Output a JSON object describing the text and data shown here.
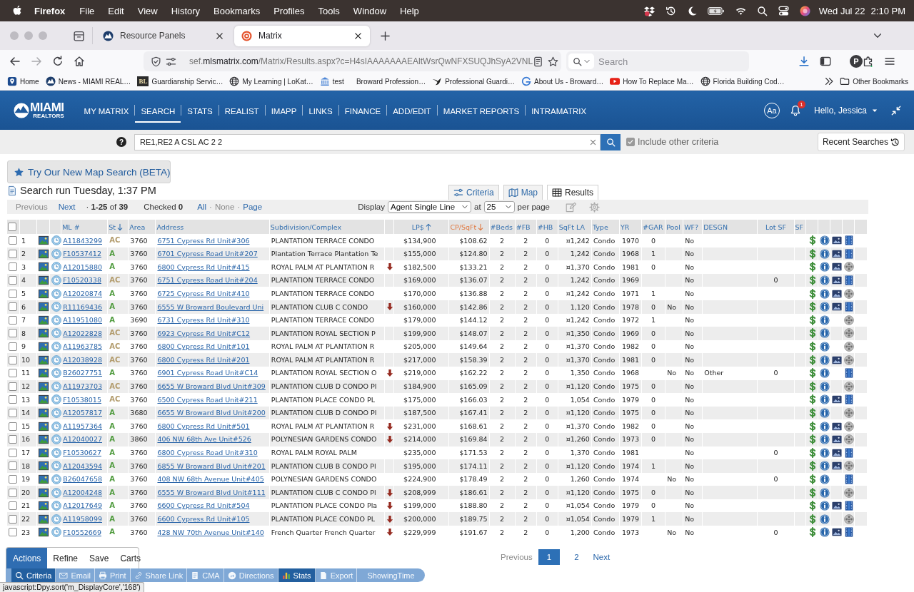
{
  "menu_bar": {
    "app": "Firefox",
    "menus": [
      "File",
      "Edit",
      "View",
      "History",
      "Bookmarks",
      "Profiles",
      "Tools",
      "Window",
      "Help"
    ],
    "date": "Wed Jul 22",
    "time": "2:10 PM"
  },
  "browser": {
    "tabs": [
      {
        "title": "Resource Panels",
        "kind": "realtors",
        "selected": false
      },
      {
        "title": "Matrix",
        "kind": "matrix",
        "selected": true
      }
    ],
    "url": {
      "subdomain": "sef.",
      "domain": "mlsmatrix.com",
      "path": "/Matrix/Results.aspx?c=H4sIAAAAAAAEAltWsrQwNFXSUQJhSyA2VNL"
    },
    "search_placeholder": "Search",
    "profile_initial": "P",
    "bookmarks": [
      {
        "label": "Home",
        "kind": "pin"
      },
      {
        "label": "News - MIAMI REAL…",
        "kind": "realtors"
      },
      {
        "label": "Guardianship Servic…",
        "kind": "monogram",
        "icon_text": "BL"
      },
      {
        "label": "My Learning | LoKat…",
        "kind": "globe"
      },
      {
        "label": "test",
        "kind": "bank"
      },
      {
        "label": "Broward Profession…"
      },
      {
        "label": "Professional Guardi…",
        "kind": "bird"
      },
      {
        "label": "About Us - Broward…",
        "kind": "swirl"
      },
      {
        "label": "How To Replace Ma…",
        "kind": "video"
      },
      {
        "label": "Florida Building Cod…",
        "kind": "globe"
      }
    ],
    "other_bookmarks": "Other Bookmarks"
  },
  "site_header": {
    "logo": {
      "title": "MIAMI",
      "subtitle": "REALTORS"
    },
    "nav": [
      {
        "label": "MY MATRIX",
        "selected": false
      },
      {
        "label": "SEARCH",
        "selected": true
      },
      {
        "label": "STATS",
        "selected": false
      },
      {
        "label": "REALIST",
        "selected": false
      },
      {
        "label": "IMAPP",
        "selected": false
      },
      {
        "label": "LINKS",
        "selected": false
      },
      {
        "label": "FINANCE",
        "selected": false
      },
      {
        "label": "ADD/EDIT",
        "selected": false
      },
      {
        "label": "MARKET REPORTS",
        "selected": false
      },
      {
        "label": "INTRAMATRIX",
        "selected": false
      }
    ],
    "text_size": "Aa",
    "notification_count": "1",
    "greeting": "Hello, Jessica"
  },
  "quick_search": {
    "help": "?",
    "value": "RE1,RE2 A CSL AC 2 2",
    "include_other": {
      "label": "Include other criteria",
      "checked": true
    },
    "recent_searches": "Recent Searches"
  },
  "map_search_button": "Try Our New Map Search (BETA)",
  "search_run": "Search run Tuesday, 1:37 PM",
  "view_tabs": [
    {
      "label": "Criteria",
      "kind": "sliders",
      "selected": false
    },
    {
      "label": "Map",
      "kind": "map",
      "selected": false
    },
    {
      "label": "Results",
      "kind": "grid",
      "selected": true
    }
  ],
  "results_toolbar": {
    "previous": {
      "label": "Previous",
      "disabled": true
    },
    "next": {
      "label": "Next",
      "disabled": false
    },
    "range": "· **1-25** of **39**",
    "checked": "Checked **0**",
    "select_links": [
      {
        "label": "All",
        "disabled": false
      },
      {
        "label": "None",
        "disabled": true
      },
      {
        "label": "Page",
        "disabled": false
      }
    ],
    "separators": [
      "·",
      "·"
    ],
    "display_label": "Display",
    "display_value": "Agent Single Line",
    "at_label": "at",
    "per_page_value": "25",
    "per_page_label": "per page"
  },
  "table": {
    "select_all_checked": false,
    "columns": [
      {
        "label": "ML #",
        "active": false
      },
      {
        "label": "St",
        "kind": "descending",
        "active": false
      },
      {
        "label": "Area",
        "active": false
      },
      {
        "label": "Address",
        "active": false
      },
      {
        "label": "Subdivision/Complex",
        "active": false
      },
      {
        "label": "LP$",
        "kind": "ascending",
        "active": false
      },
      {
        "label": "CP/SqFt",
        "kind": "descending",
        "active": true
      },
      {
        "label": "#Beds",
        "active": false
      },
      {
        "label": "#FB",
        "active": false
      },
      {
        "label": "#HB",
        "active": false
      },
      {
        "label": "SqFt LA",
        "active": false
      },
      {
        "label": "Type",
        "active": false
      },
      {
        "label": "YR",
        "active": false
      },
      {
        "label": "#GAR",
        "active": false
      },
      {
        "label": "Pool",
        "active": false
      },
      {
        "label": "WF?",
        "active": false
      },
      {
        "label": "DESGN",
        "active": false
      },
      {
        "label": "Lot SF",
        "active": false
      },
      {
        "label": "SF",
        "active": false
      }
    ],
    "rows": [
      {
        "checked": false,
        "number": "1",
        "ml": "A11843299",
        "status": {
          "text": "AC",
          "color": "#b29b6c"
        },
        "area": "3760",
        "address": "6751 Cypress Rd Unit#306",
        "subdivision": "PLANTATION TERRACE CONDO",
        "reduced": false,
        "lp": "$134,900",
        "cp_sqft": "$108.62",
        "beds": "2",
        "fb": "2",
        "hb": "0",
        "sqft": "¤1,242",
        "type": "Condo",
        "yr": "1970",
        "gar": "0",
        "wf": "No",
        "photos": true,
        "kind": "film"
      },
      {
        "checked": false,
        "number": "2",
        "ml": "F10537412",
        "status": {
          "text": "A",
          "color": "#4e9a3c"
        },
        "area": "3760",
        "address": "6701 Cypress Road Unit#207",
        "subdivision": "Plantation Terrace Plantation Te",
        "reduced": false,
        "lp": "$155,000",
        "cp_sqft": "$124.80",
        "beds": "2",
        "fb": "2",
        "hb": "0",
        "sqft": "1,242",
        "type": "Condo",
        "yr": "1968",
        "gar": "1",
        "wf": "No",
        "photos": true,
        "kind": "film"
      },
      {
        "checked": false,
        "number": "3",
        "ml": "A12015880",
        "status": {
          "text": "A",
          "color": "#4e9a3c"
        },
        "area": "3760",
        "address": "6800 Cypress Rd Unit#415",
        "subdivision": "ROYAL PALM AT PLANTATION R",
        "reduced": true,
        "lp": "$182,500",
        "cp_sqft": "$133.21",
        "beds": "2",
        "fb": "2",
        "hb": "0",
        "sqft": "¤1,370",
        "type": "Condo",
        "yr": "1981",
        "gar": "0",
        "wf": "No",
        "photos": true,
        "kind": "reel"
      },
      {
        "checked": false,
        "number": "4",
        "ml": "F10520338",
        "status": {
          "text": "AC",
          "color": "#b29b6c"
        },
        "area": "3760",
        "address": "6751 Cypress Road Unit#204",
        "subdivision": "PLANTATION TERRACE CONDO",
        "reduced": false,
        "lp": "$169,000",
        "cp_sqft": "$136.07",
        "beds": "2",
        "fb": "2",
        "hb": "0",
        "sqft": "1,242",
        "type": "Condo",
        "yr": "1969",
        "wf": "No",
        "lot": "0",
        "photos": true,
        "kind": "film"
      },
      {
        "checked": false,
        "number": "5",
        "ml": "A12020874",
        "status": {
          "text": "A",
          "color": "#4e9a3c"
        },
        "area": "3760",
        "address": "6725 Cypress Rd Unit#410",
        "subdivision": "PLANTATION TERRACE CONDO",
        "reduced": false,
        "lp": "$170,000",
        "cp_sqft": "$136.88",
        "beds": "2",
        "fb": "2",
        "hb": "0",
        "sqft": "¤1,242",
        "type": "Condo",
        "yr": "1971",
        "gar": "1",
        "wf": "No",
        "photos": true,
        "kind": "reel"
      },
      {
        "checked": false,
        "number": "6",
        "ml": "R11169436",
        "status": {
          "text": "A",
          "color": "#4e9a3c"
        },
        "area": "3760",
        "address": "6555 W Broward Boulevard Uni",
        "subdivision": "PLANTATION CLUB C CONDO",
        "reduced": true,
        "lp": "$160,000",
        "cp_sqft": "$142.86",
        "beds": "2",
        "fb": "2",
        "hb": "0",
        "sqft": "1,120",
        "type": "Condo",
        "yr": "1978",
        "gar": "0",
        "pool": "No",
        "wf": "No",
        "photos": true,
        "kind": "film"
      },
      {
        "checked": false,
        "number": "7",
        "ml": "A11951080",
        "status": {
          "text": "A",
          "color": "#4e9a3c"
        },
        "area": "3690",
        "address": "6731 Cypress Rd Unit#310",
        "subdivision": "PLANTATION TERRACE CONDO",
        "reduced": false,
        "lp": "$179,000",
        "cp_sqft": "$144.12",
        "beds": "2",
        "fb": "2",
        "hb": "0",
        "sqft": "¤1,242",
        "type": "Condo",
        "yr": "1972",
        "gar": "1",
        "wf": "No",
        "photos": false,
        "kind": "reel"
      },
      {
        "checked": false,
        "number": "8",
        "ml": "A12022828",
        "status": {
          "text": "AC",
          "color": "#b29b6c"
        },
        "area": "3760",
        "address": "6923 Cypress Rd Unit#C12",
        "subdivision": "PLANTATION ROYAL SECTION P",
        "reduced": false,
        "lp": "$199,900",
        "cp_sqft": "$148.07",
        "beds": "2",
        "fb": "2",
        "hb": "0",
        "sqft": "¤1,350",
        "type": "Condo",
        "yr": "1969",
        "gar": "0",
        "wf": "No",
        "photos": false,
        "kind": "reel"
      },
      {
        "checked": false,
        "number": "9",
        "ml": "A11963785",
        "status": {
          "text": "AC",
          "color": "#b29b6c"
        },
        "area": "3760",
        "address": "6800 Cypress Rd Unit#101",
        "subdivision": "ROYAL PALM AT PLANTATION R",
        "reduced": false,
        "lp": "$205,000",
        "cp_sqft": "$149.64",
        "beds": "2",
        "fb": "2",
        "hb": "0",
        "sqft": "¤1,370",
        "type": "Condo",
        "yr": "1982",
        "gar": "0",
        "wf": "No",
        "photos": false,
        "kind": "reel"
      },
      {
        "checked": false,
        "number": "10",
        "ml": "A12038928",
        "status": {
          "text": "AC",
          "color": "#b29b6c"
        },
        "area": "3760",
        "address": "6800 Cypress Rd Unit#201",
        "subdivision": "ROYAL PALM AT PLANTATION R",
        "reduced": false,
        "lp": "$217,000",
        "cp_sqft": "$158.39",
        "beds": "2",
        "fb": "2",
        "hb": "0",
        "sqft": "¤1,370",
        "type": "Condo",
        "yr": "1981",
        "gar": "0",
        "wf": "No",
        "photos": true,
        "kind": "reel"
      },
      {
        "checked": false,
        "number": "11",
        "ml": "B26027751",
        "status": {
          "text": "A",
          "color": "#4e9a3c"
        },
        "area": "3760",
        "address": "6901 Cypress Road Unit#C14",
        "subdivision": "PLANTATION ROYAL SECTION O",
        "reduced": true,
        "lp": "$219,000",
        "cp_sqft": "$162.22",
        "beds": "2",
        "fb": "2",
        "hb": "0",
        "sqft": "1,350",
        "type": "Condo",
        "yr": "1968",
        "pool": "No",
        "wf": "No",
        "desgn": "Other",
        "lot": "0",
        "photos": false,
        "kind": "film"
      },
      {
        "checked": false,
        "number": "12",
        "ml": "A11973703",
        "status": {
          "text": "AC",
          "color": "#b29b6c"
        },
        "area": "3760",
        "address": "6655 W Broward Blvd Unit#309",
        "subdivision": "PLANTATION CLUB D CONDO Pl",
        "reduced": false,
        "lp": "$184,900",
        "cp_sqft": "$165.09",
        "beds": "2",
        "fb": "2",
        "hb": "0",
        "sqft": "¤1,120",
        "type": "Condo",
        "yr": "1975",
        "gar": "0",
        "wf": "No",
        "photos": false,
        "kind": "reel"
      },
      {
        "checked": false,
        "number": "13",
        "ml": "F10538015",
        "status": {
          "text": "AC",
          "color": "#b29b6c"
        },
        "area": "3760",
        "address": "6500 Cypress Road Unit#211",
        "subdivision": "PLANTATION PLACE CONDO PL",
        "reduced": false,
        "lp": "$175,000",
        "cp_sqft": "$166.03",
        "beds": "2",
        "fb": "2",
        "hb": "0",
        "sqft": "1,054",
        "type": "Condo",
        "yr": "1979",
        "gar": "0",
        "wf": "No",
        "photos": true,
        "kind": "film"
      },
      {
        "checked": false,
        "number": "14",
        "ml": "A12057817",
        "status": {
          "text": "A",
          "color": "#4e9a3c"
        },
        "area": "3680",
        "address": "6655 W Broward Blvd Unit#200",
        "subdivision": "PLANTATION CLUB D CONDO Pl",
        "reduced": false,
        "lp": "$187,500",
        "cp_sqft": "$167.41",
        "beds": "2",
        "fb": "2",
        "hb": "0",
        "sqft": "¤1,120",
        "type": "Condo",
        "yr": "1975",
        "gar": "0",
        "wf": "No",
        "photos": false,
        "kind": "reel"
      },
      {
        "checked": false,
        "number": "15",
        "ml": "A11957364",
        "status": {
          "text": "A",
          "color": "#4e9a3c"
        },
        "area": "3760",
        "address": "6800 Cypress Rd Unit#501",
        "subdivision": "ROYAL PALM AT PLANTATION R",
        "reduced": true,
        "lp": "$231,000",
        "cp_sqft": "$168.61",
        "beds": "2",
        "fb": "2",
        "hb": "0",
        "sqft": "¤1,370",
        "type": "Condo",
        "yr": "1982",
        "gar": "0",
        "wf": "No",
        "photos": true,
        "kind": "reel"
      },
      {
        "checked": false,
        "number": "16",
        "ml": "A12040027",
        "status": {
          "text": "A",
          "color": "#4e9a3c"
        },
        "area": "3860",
        "address": "406 NW 68th Ave Unit#526",
        "subdivision": "POLYNESIAN GARDENS CONDO",
        "reduced": true,
        "lp": "$214,000",
        "cp_sqft": "$169.84",
        "beds": "2",
        "fb": "2",
        "hb": "0",
        "sqft": "¤1,260",
        "type": "Condo",
        "yr": "1973",
        "gar": "0",
        "wf": "No",
        "photos": true,
        "kind": "reel"
      },
      {
        "checked": false,
        "number": "17",
        "ml": "F10530627",
        "status": {
          "text": "A",
          "color": "#4e9a3c"
        },
        "area": "3760",
        "address": "6800 Cypress Road Unit#310",
        "subdivision": "ROYAL PALM ROYAL PALM",
        "reduced": false,
        "lp": "$235,000",
        "cp_sqft": "$171.53",
        "beds": "2",
        "fb": "2",
        "hb": "0",
        "sqft": "1,370",
        "type": "Condo",
        "yr": "1981",
        "wf": "No",
        "lot": "0",
        "photos": true,
        "kind": "film"
      },
      {
        "checked": false,
        "number": "18",
        "ml": "A12043594",
        "status": {
          "text": "A",
          "color": "#4e9a3c"
        },
        "area": "3760",
        "address": "6855 W Broward Blvd Unit#201",
        "subdivision": "PLANTATION CLUB B CONDO Pl",
        "reduced": false,
        "lp": "$195,000",
        "cp_sqft": "$174.11",
        "beds": "2",
        "fb": "2",
        "hb": "0",
        "sqft": "¤1,120",
        "type": "Condo",
        "yr": "1974",
        "gar": "1",
        "wf": "No",
        "photos": true,
        "kind": "reel"
      },
      {
        "checked": false,
        "number": "19",
        "ml": "B26047658",
        "status": {
          "text": "A",
          "color": "#4e9a3c"
        },
        "area": "3760",
        "address": "408 NW 68th Avenue Unit#405",
        "subdivision": "POLYNESIAN GARDENS CONDO",
        "reduced": false,
        "lp": "$224,900",
        "cp_sqft": "$178.49",
        "beds": "2",
        "fb": "2",
        "hb": "0",
        "sqft": "1,260",
        "type": "Condo",
        "yr": "1974",
        "pool": "No",
        "wf": "No",
        "lot": "0",
        "photos": false,
        "kind": "film"
      },
      {
        "checked": false,
        "number": "20",
        "ml": "A12004248",
        "status": {
          "text": "A",
          "color": "#4e9a3c"
        },
        "area": "3760",
        "address": "6555 W Broward Blvd Unit#111",
        "subdivision": "PLANTATION CLUB C CONDO Pl",
        "reduced": true,
        "lp": "$208,999",
        "cp_sqft": "$186.61",
        "beds": "2",
        "fb": "2",
        "hb": "0",
        "sqft": "¤1,120",
        "type": "Condo",
        "yr": "1975",
        "gar": "0",
        "wf": "No",
        "photos": false,
        "kind": "reel"
      },
      {
        "checked": false,
        "number": "21",
        "ml": "A12017649",
        "status": {
          "text": "A",
          "color": "#4e9a3c"
        },
        "area": "3760",
        "address": "6600 Cypress Rd Unit#504",
        "subdivision": "PLANTATION PLACE CONDO Pla",
        "reduced": true,
        "lp": "$199,000",
        "cp_sqft": "$188.80",
        "beds": "2",
        "fb": "2",
        "hb": "0",
        "sqft": "¤1,054",
        "type": "Condo",
        "yr": "1979",
        "gar": "0",
        "wf": "No",
        "photos": true,
        "kind": "film"
      },
      {
        "checked": false,
        "number": "22",
        "ml": "A11958099",
        "status": {
          "text": "A",
          "color": "#4e9a3c"
        },
        "area": "3760",
        "address": "6600 Cypress Rd Unit#105",
        "subdivision": "PLANTATION PLACE CONDO PL",
        "reduced": true,
        "lp": "$200,000",
        "cp_sqft": "$189.75",
        "beds": "2",
        "fb": "2",
        "hb": "0",
        "sqft": "¤1,054",
        "type": "Condo",
        "yr": "1979",
        "gar": "1",
        "wf": "No",
        "photos": false,
        "kind": "reel"
      },
      {
        "checked": false,
        "number": "23",
        "ml": "F10552669",
        "status": {
          "text": "A",
          "color": "#4e9a3c"
        },
        "area": "3760",
        "address": "428 NW 70th Avenue Unit#140",
        "subdivision": "French Quarter French Quarter",
        "reduced": true,
        "lp": "$229,999",
        "cp_sqft": "$191.67",
        "beds": "2",
        "fb": "2",
        "hb": "0",
        "sqft": "1,200",
        "type": "Condo",
        "yr": "1973",
        "pool": "No",
        "wf": "No",
        "lot": "0",
        "photos": true,
        "kind": "film"
      }
    ]
  },
  "pagination": {
    "previous": {
      "label": "Previous",
      "disabled": true
    },
    "pages": [
      {
        "label": "1",
        "selected": true
      },
      {
        "label": "2",
        "selected": false
      }
    ],
    "next": {
      "label": "Next",
      "disabled": false
    }
  },
  "actions_panel": {
    "tabs": [
      {
        "label": "Actions",
        "selected": true
      },
      {
        "label": "Refine",
        "selected": false
      },
      {
        "label": "Save",
        "selected": false
      },
      {
        "label": "Carts",
        "selected": false
      }
    ],
    "buttons": [
      {
        "label": "Criteria",
        "kind": "search",
        "disabled": false
      },
      {
        "label": "Email",
        "kind": "mail",
        "disabled": true
      },
      {
        "label": "Print",
        "kind": "print",
        "disabled": true
      },
      {
        "label": "Share Link",
        "kind": "link",
        "disabled": true
      },
      {
        "label": "CMA",
        "kind": "report",
        "disabled": true
      },
      {
        "label": "Directions",
        "kind": "directions",
        "disabled": true
      },
      {
        "label": "Stats",
        "kind": "stats",
        "disabled": false
      },
      {
        "label": "Export",
        "kind": "file",
        "disabled": true
      },
      {
        "label": "ShowingTime",
        "disabled": true
      }
    ]
  },
  "status_url": "javascript:Dpy.sort('m_DisplayCore','168')"
}
